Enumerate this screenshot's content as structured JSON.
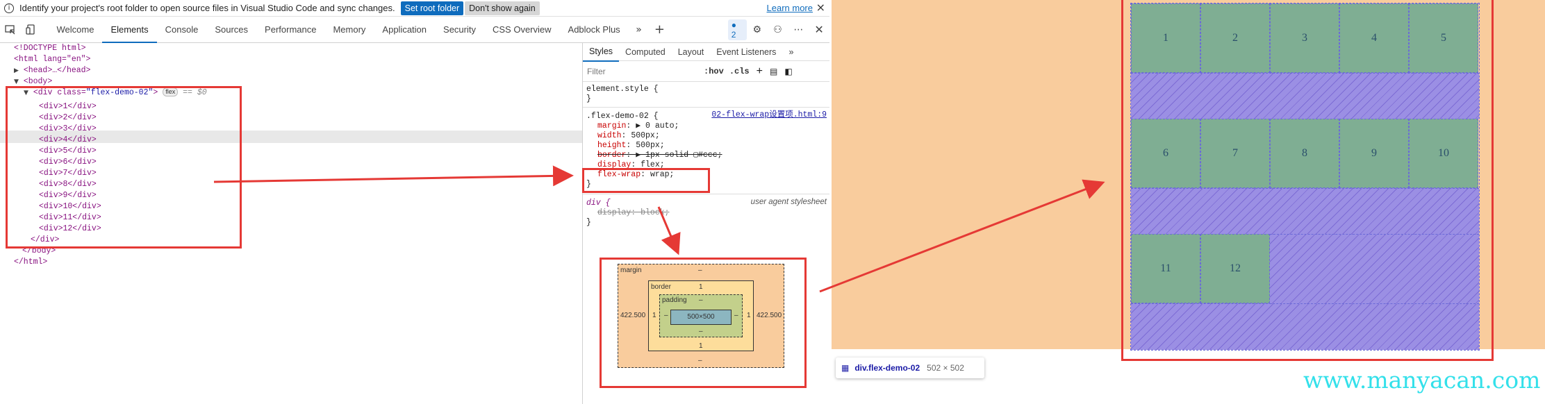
{
  "infobar": {
    "message": "Identify your project's root folder to open source files in Visual Studio Code and sync changes.",
    "set_root": "Set root folder",
    "dont_show": "Don't show again",
    "learn_more": "Learn more",
    "close": "×"
  },
  "tabs": [
    "Welcome",
    "Elements",
    "Console",
    "Sources",
    "Performance",
    "Memory",
    "Application",
    "Security",
    "CSS Overview",
    "Adblock Plus"
  ],
  "active_tab": "Elements",
  "issues_count": "2",
  "dom": {
    "doctype": "<!DOCTYPE html>",
    "html_open": "<html lang=\"en\">",
    "head": "<head>…</head>",
    "body_open": "<body>",
    "div_open_tag": "<div class=",
    "div_class": "\"flex-demo-02\"",
    "flex_badge": "flex",
    "eq": "== $0",
    "children": [
      "<div>1</div>",
      "<div>2</div>",
      "<div>3</div>",
      "<div>4</div>",
      "<div>5</div>",
      "<div>6</div>",
      "<div>7</div>",
      "<div>8</div>",
      "<div>9</div>",
      "<div>10</div>",
      "<div>11</div>",
      "<div>12</div>"
    ],
    "div_close": "</div>",
    "body_close": "</body>",
    "html_close": "</html>"
  },
  "styles": {
    "tabs": [
      "Styles",
      "Computed",
      "Layout",
      "Event Listeners"
    ],
    "filter_placeholder": "Filter",
    "hov": ":hov",
    "cls": ".cls",
    "element_style": "element.style {",
    "close_brace": "}",
    "rule_selector": ".flex-demo-02 {",
    "rule_source": "02-flex-wrap设置项.html:9",
    "props": [
      {
        "name": "margin",
        "value": "▶ 0 auto;"
      },
      {
        "name": "width",
        "value": "500px;"
      },
      {
        "name": "height",
        "value": "500px;"
      },
      {
        "name": "border",
        "value": "▶ 1px solid ▢#ccc;"
      },
      {
        "name": "display",
        "value": "flex;"
      },
      {
        "name": "flex-wrap",
        "value": "wrap;"
      }
    ],
    "ua_selector": "div {",
    "ua_label": "user agent stylesheet",
    "ua_prop": "display: block;"
  },
  "boxmodel": {
    "margin_label": "margin",
    "border_label": "border",
    "padding_label": "padding",
    "dash": "–",
    "margin_left": "422.500",
    "margin_right": "422.500",
    "border_value": "1",
    "content": "500×500"
  },
  "page": {
    "cells": [
      "1",
      "2",
      "3",
      "4",
      "5",
      "6",
      "7",
      "8",
      "9",
      "10",
      "11",
      "12"
    ],
    "tooltip_name": "div.flex-demo-02",
    "tooltip_size": "502 × 502",
    "watermark": "www.manyacan.com",
    "bg_color": "#f9cc9d",
    "cell_color": "#7fae93",
    "gap_color": "#9b8fe4"
  }
}
